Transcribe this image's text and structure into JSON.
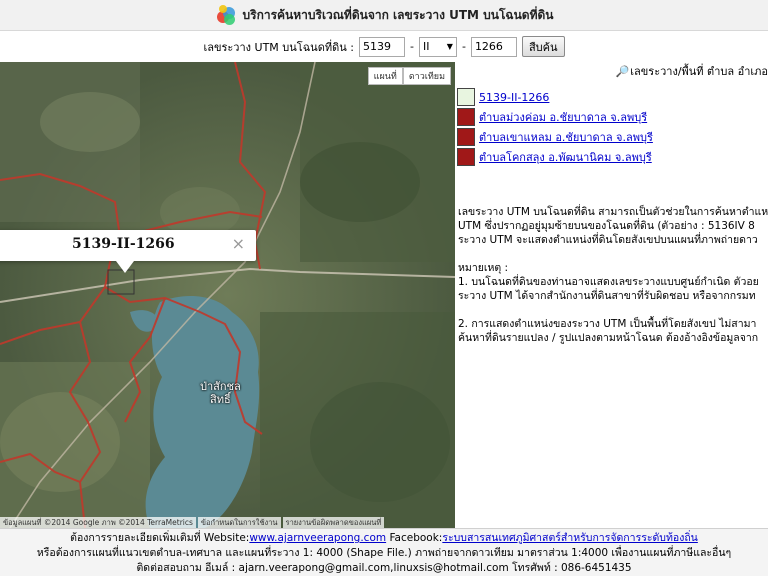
{
  "header": {
    "title": "บริการค้นหาบริเวณที่ดินจาก เลขระวาง UTM บนโฉนดที่ดิน"
  },
  "search": {
    "label": "เลขระวาง UTM บนโฉนดที่ดิน :",
    "sheet_value": "5139",
    "dash1": "-",
    "roman_value": "II",
    "dash2": "-",
    "number_value": "1266",
    "button_label": "สืบค้น"
  },
  "map": {
    "type_buttons": [
      "แผนที่",
      "ดาวเทียม"
    ],
    "popup_title": "5139-II-1266",
    "popup_close": "×",
    "place_label_line1": "ป่าสักชล",
    "place_label_line2": "สิทธิ์",
    "attribution": "ข้อมูลแผนที่ ©2014 Google ภาพ ©2014 TerraMetrics",
    "terms": "ข้อกำหนดในการใช้งาน",
    "report": "รายงานข้อผิดพลาดของแผนที่"
  },
  "panel": {
    "heading": "เลขระวาง/พื้นที่ ตำบล อำเภอ",
    "results": [
      {
        "label": "5139-II-1266",
        "color": "#e8f5e0"
      },
      {
        "label": "ตำบลม่วงค่อม อ.ชัยบาดาล จ.ลพบุรี",
        "color": "#a01818"
      },
      {
        "label": "ตำบลเขาแหลม อ.ชัยบาดาล จ.ลพบุรี",
        "color": "#a01818"
      },
      {
        "label": "ตำบลโคกสลุง อ.พัฒนานิคม จ.ลพบุรี",
        "color": "#a01818"
      }
    ],
    "desc1_line1": "เลขระวาง UTM บนโฉนดที่ดิน สามารถเป็นตัวช่วยในการค้นหาตำแหน่ง",
    "desc1_line2": "UTM ซึ่งปรากฏอยู่มุมซ้ายบนของโฉนดที่ดิน (ตัวอย่าง : 5136IV 8",
    "desc1_line3": "ระวาง UTM จะแสดงตำแหน่งที่ดินโดยสังเขปบนแผนที่ภาพถ่ายดาว",
    "note_title": "หมายเหตุ :",
    "note1_line1": "1. บนโฉนดที่ดินของท่านอาจแสดงเลขระวางแบบศูนย์กำเนิด ตัวอย",
    "note1_line2": "ระวาง UTM ได้จากสำนักงานที่ดินสาขาที่รับผิดชอบ หรือจากกรมท",
    "note2_line1": "2. การแสดงตำแหน่งของระวาง UTM เป็นพื้นที่โดยสังเขป ไม่สามา",
    "note2_line2": "ค้นหาที่ดินรายแปลง / รูปแปลงตามหน้าโฉนด ต้องอ้างอิงข้อมูลจาก"
  },
  "footer": {
    "line1_prefix": "ต้องการรายละเอียดเพิ่มเติมที่ Website:",
    "line1_site": "www.ajarnveerapong.com",
    "line1_mid": " Facebook:",
    "line1_fb": "ระบบสารสนเทศภูมิศาสตร์สำหรับการจัดการระดับท้องถิ่น",
    "line2": "หรือต้องการแผนที่แนวเขตตำบล-เทศบาล และแผนที่ระวาง 1: 4000 (Shape File.) ภาพถ่ายจากดาวเทียม มาตราส่วน 1:4000 เพื่องานแผนที่ภาษีและอื่นๆ",
    "line3": "ติดต่อสอบถาม อีเมล์ : ajarn.veerapong@gmail.com,linuxsis@hotmail.com โทรศัพท์ : 086-6451435"
  },
  "colors": {
    "boundary": "#c0392b",
    "water": "#5b8a94",
    "land": "#57664a"
  }
}
